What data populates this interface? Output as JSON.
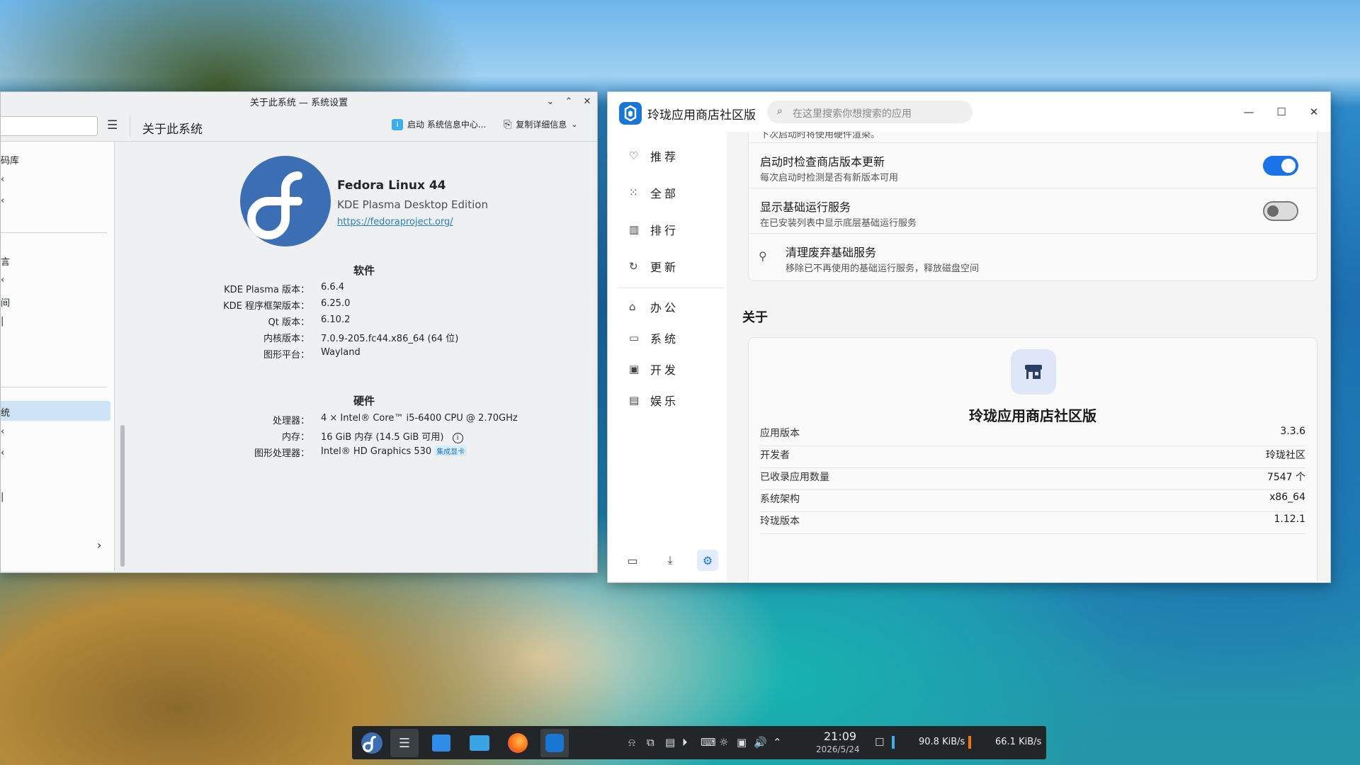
{
  "kde_window": {
    "title": "关于此系统 — 系统设置",
    "page_title": "关于此系统",
    "btn_info_center": "启动 系统信息中心...",
    "btn_copy": "复制详细信息",
    "sidebar_items": [
      "码库",
      "‹",
      "‹",
      "言",
      "‹",
      "间",
      "|",
      "统",
      "‹",
      "‹",
      "|"
    ],
    "os_name": "Fedora Linux 44",
    "edition": "KDE Plasma Desktop Edition",
    "url": "https://fedoraproject.org/",
    "software_heading": "软件",
    "software": [
      {
        "k": "KDE Plasma 版本：",
        "v": "6.6.4"
      },
      {
        "k": "KDE 程序框架版本：",
        "v": "6.25.0"
      },
      {
        "k": "Qt 版本：",
        "v": "6.10.2"
      },
      {
        "k": "内核版本：",
        "v": "7.0.9-205.fc44.x86_64 (64 位)"
      },
      {
        "k": "图形平台：",
        "v": "Wayland"
      }
    ],
    "hardware_heading": "硬件",
    "hardware": [
      {
        "k": "处理器：",
        "v": "4 × Intel® Core™ i5-6400 CPU @ 2.70GHz"
      },
      {
        "k": "内存：",
        "v": "16 GiB 内存 (14.5 GiB 可用)"
      },
      {
        "k": "图形处理器：",
        "v": "Intel® HD Graphics 530"
      }
    ],
    "gpu_badge": "集成显卡"
  },
  "ll_window": {
    "app_name": "玲珑应用商店社区版",
    "search_placeholder": "在这里搜索你想搜索的应用",
    "nav": [
      {
        "icon": "heart-icon",
        "glyph": "♡",
        "label": "推荐"
      },
      {
        "icon": "grid-icon",
        "glyph": "⁙",
        "label": "全部"
      },
      {
        "icon": "ranking-icon",
        "glyph": "▥",
        "label": "排行"
      },
      {
        "icon": "update-icon",
        "glyph": "↻",
        "label": "更新"
      },
      {
        "icon": "briefcase-icon",
        "glyph": "⌂",
        "label": "办公"
      },
      {
        "icon": "monitor-icon",
        "glyph": "▭",
        "label": "系统"
      },
      {
        "icon": "terminal-icon",
        "glyph": "▣",
        "label": "开发"
      },
      {
        "icon": "clapperboard-icon",
        "glyph": "▤",
        "label": "娱乐"
      }
    ],
    "cut_text": "下次启动时将使用硬件渲染。",
    "settings": [
      {
        "title": "启动时检查商店版本更新",
        "desc": "每次启动时检测是否有新版本可用",
        "toggle": "on"
      },
      {
        "title": "显示基础运行服务",
        "desc": "在已安装列表中显示底层基础运行服务",
        "toggle": "off"
      },
      {
        "title": "清理废弃基础服务",
        "desc": "移除已不再使用的基础运行服务，释放磁盘空间",
        "toggle": "none"
      }
    ],
    "about_heading": "关于",
    "about_name": "玲珑应用商店社区版",
    "info": [
      {
        "k": "应用版本",
        "v": "3.3.6"
      },
      {
        "k": "开发者",
        "v": "玲珑社区"
      },
      {
        "k": "已收录应用数量",
        "v": "7547 个"
      },
      {
        "k": "系统架构",
        "v": "x86_64"
      },
      {
        "k": "玲珑版本",
        "v": "1.12.1"
      }
    ]
  },
  "taskbar": {
    "time": "21:09",
    "date": "2026/5/24",
    "net_down": "90.8 KiB/s",
    "net_up": "66.1 KiB/s"
  },
  "colors": {
    "accent": "#1a73e8",
    "kde_link": "#2980b9",
    "taskbar": "#232629"
  }
}
